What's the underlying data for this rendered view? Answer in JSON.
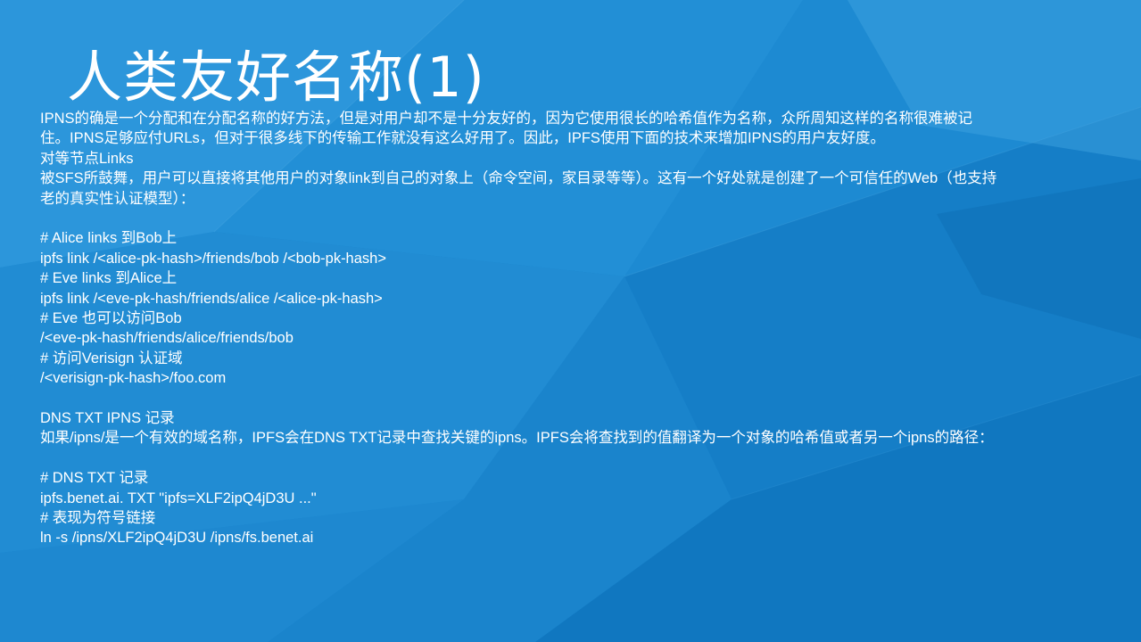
{
  "slide": {
    "title": "人类友好名称(1)",
    "background_color": "#1a86cf",
    "lines": [
      "IPNS的确是一个分配和在分配名称的好方法，但是对用户却不是十分友好的，因为它使用很长的哈希值作为名称，众所周知这样的名称很难被记住。IPNS足够应付URLs，但对于很多线下的传输工作就没有这么好用了。因此，IPFS使用下面的技术来增加IPNS的用户友好度。",
      "对等节点Links",
      "被SFS所鼓舞，用户可以直接将其他用户的对象link到自己的对象上（命令空间，家目录等等）。这有一个好处就是创建了一个可信任的Web（也支持老的真实性认证模型）：",
      "",
      "# Alice links 到Bob上",
      "ipfs link /<alice-pk-hash>/friends/bob /<bob-pk-hash>",
      "# Eve links 到Alice上",
      "ipfs link /<eve-pk-hash/friends/alice /<alice-pk-hash>",
      "# Eve 也可以访问Bob",
      "/<eve-pk-hash/friends/alice/friends/bob",
      "# 访问Verisign 认证域",
      "/<verisign-pk-hash>/foo.com",
      "",
      "DNS TXT IPNS 记录",
      "如果/ipns/是一个有效的域名称，IPFS会在DNS TXT记录中查找关键的ipns。IPFS会将查找到的值翻译为一个对象的哈希值或者另一个ipns的路径：",
      "",
      "# DNS TXT 记录",
      "ipfs.benet.ai. TXT \"ipfs=XLF2ipQ4jD3U ...\"",
      "# 表现为符号链接",
      "ln -s /ipns/XLF2ipQ4jD3U /ipns/fs.benet.ai"
    ]
  }
}
